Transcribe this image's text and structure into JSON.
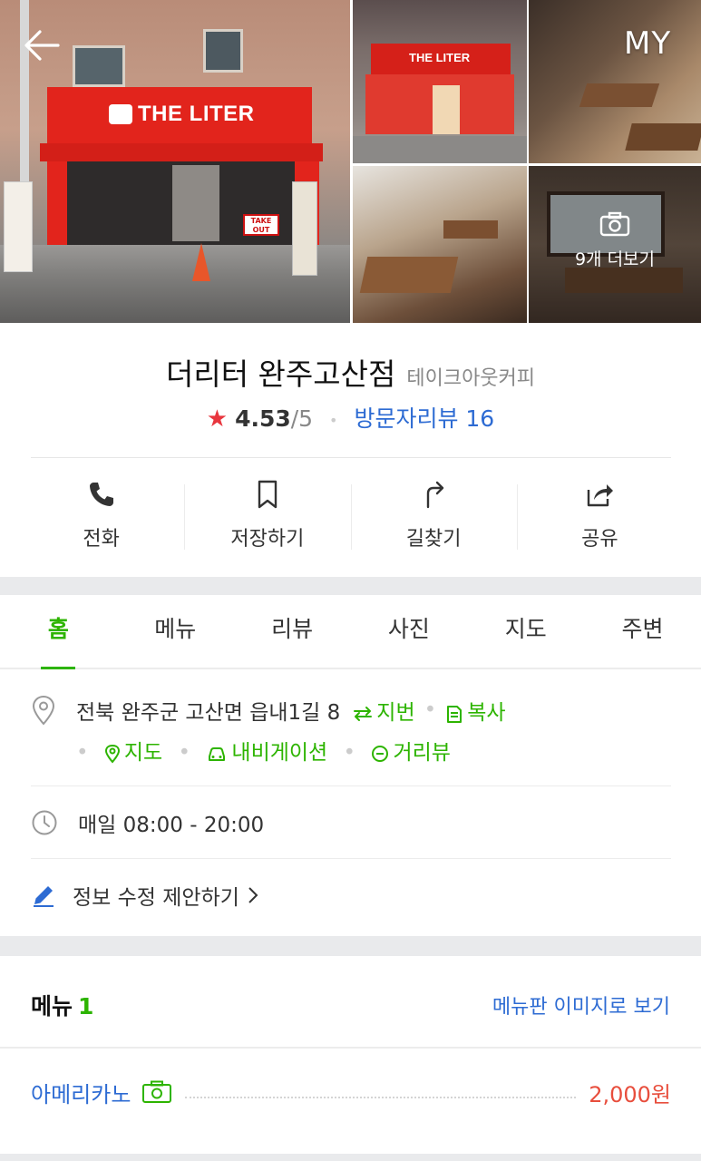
{
  "gallery": {
    "store_sign": "THE LITER",
    "takeout_sign": "TAKE OUT",
    "my_label": "MY",
    "more_photos_label": "9개 더보기"
  },
  "place": {
    "name": "더리터 완주고산점",
    "category": "테이크아웃커피",
    "rating": "4.53",
    "rating_max": "/5",
    "review_link": "방문자리뷰 16"
  },
  "actions": [
    {
      "label": "전화",
      "icon": "phone-icon"
    },
    {
      "label": "저장하기",
      "icon": "bookmark-icon"
    },
    {
      "label": "길찾기",
      "icon": "directions-icon"
    },
    {
      "label": "공유",
      "icon": "share-icon"
    }
  ],
  "tabs": [
    "홈",
    "메뉴",
    "리뷰",
    "사진",
    "지도",
    "주변"
  ],
  "active_tab": "홈",
  "info": {
    "address": "전북 완주군 고산면 읍내1길 8",
    "lot_number_link": "지번",
    "copy_link": "복사",
    "map_link": "지도",
    "navigation_link": "내비게이션",
    "streetview_link": "거리뷰",
    "hours": "매일 08:00 - 20:00",
    "suggest_edit": "정보 수정 제안하기"
  },
  "menu": {
    "heading": "메뉴",
    "count": "1",
    "board_link": "메뉴판 이미지로 보기",
    "items": [
      {
        "name": "아메리카노",
        "price": "2,000원"
      }
    ]
  },
  "colors": {
    "green_accent": "#2db400",
    "link_blue": "#2d6bd3",
    "price_red": "#e84e3d",
    "star_red": "#e8363e"
  }
}
